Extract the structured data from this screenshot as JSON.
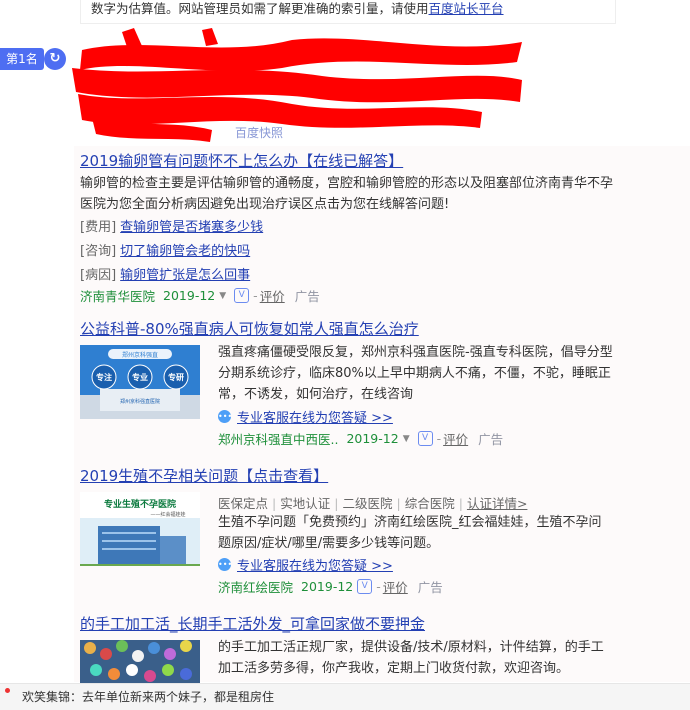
{
  "tip": {
    "text": "数字为估算值。网站管理员如需了解更准确的索引量，请使用",
    "link": "百度站长平台"
  },
  "rank": {
    "label": "第1名"
  },
  "redacted_hint": "百度快照",
  "results": [
    {
      "title": "2019输卵管有问题怀不上怎么办【在线已解答】",
      "desc_lines": [
        "输卵管的检查主要是评估输卵管的通畅度，宫腔和输卵管腔的形态以及阻塞部位济南青华不孕",
        "医院为您全面分析病因避免出现治疗误区点击为您在线解答问题!"
      ],
      "sublinks": [
        {
          "tag": "[费用]",
          "text": "查输卵管是否堵塞多少钱"
        },
        {
          "tag": "[咨询]",
          "text": "切了输卵管会老的快吗"
        },
        {
          "tag": "[病因]",
          "text": "输卵管扩张是怎么回事"
        }
      ],
      "source": "济南青华医院",
      "date": "2019-12",
      "eval": "评价",
      "ad": "广告"
    },
    {
      "title": "公益科普-80%强直病人可恢复如常人强直怎么治疗",
      "thumb_title": "郑州京科强直",
      "thumb_words": [
        "专注",
        "专业",
        "专研"
      ],
      "thumb_caption": "郑州京科强直医院",
      "desc_lines": [
        "强直疼痛僵硬受限反复，郑州京科强直医院-强直专科医院，倡导分型",
        "分期系统诊疗，临床80%以上早中期病人不痛，不僵，不驼，睡眠正",
        "常，不诱发，如何治疗，在线咨询"
      ],
      "service": "专业客服在线为您答疑 >>",
      "source": "郑州京科强直中西医..",
      "date": "2019-12",
      "eval": "评价",
      "ad": "广告"
    },
    {
      "title": "2019生殖不孕相关问题【点击查看】",
      "thumb_title": "专业生殖不孕医院",
      "thumb_sub": "——红会福娃娃",
      "tags": [
        "医保定点",
        "实地认证",
        "二级医院",
        "综合医院"
      ],
      "auth_link": "认证详情>",
      "desc_lines": [
        "生殖不孕问题「免费预约」济南红绘医院_红会福娃娃，生殖不孕问",
        "题原因/症状/哪里/需要多少钱等问题。"
      ],
      "service": "专业客服在线为您答疑 >>",
      "source": "济南红绘医院",
      "date": "2019-12",
      "eval": "评价",
      "ad": "广告"
    },
    {
      "title": "的手工加工活_长期手工活外发_可拿回家做不要押金",
      "desc_lines": [
        "的手工加工活正规厂家，提供设备/技术/原材料，计件结算，的手工",
        "加工活多劳多得，你产我收，定期上门收货付款，欢迎咨询。"
      ]
    }
  ],
  "bottom_bar": {
    "text": "欢笑集锦：去年单位新来两个妹子，都是租房住"
  },
  "colors": {
    "link": "#2440b3",
    "source_green": "#1e8f3a",
    "rank_blue": "#4e6ef2",
    "redact_red": "#ff0000"
  }
}
